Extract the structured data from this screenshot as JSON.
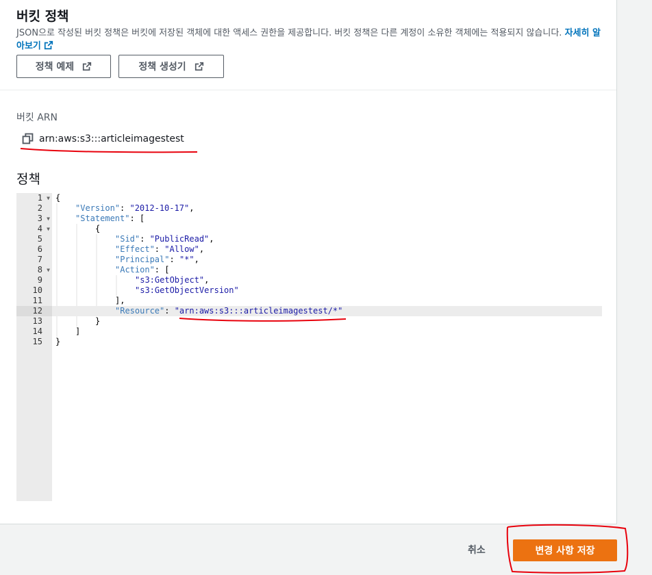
{
  "header": {
    "title": "버킷 정책",
    "description": "JSON으로 작성된 버킷 정책은 버킷에 저장된 객체에 대한 액세스 권한을 제공합니다. 버킷 정책은 다른 계정이 소유한 객체에는 적용되지 않습니다.",
    "learn_more": "자세히 알아보기",
    "buttons": {
      "example": "정책 예제",
      "generator": "정책 생성기"
    }
  },
  "arn": {
    "label": "버킷 ARN",
    "value": "arn:aws:s3:::articleimagestest",
    "icon": "copy-icon"
  },
  "policy": {
    "label": "정책",
    "lines": [
      {
        "n": "1",
        "fold": true,
        "indent": 0,
        "parts": [
          {
            "t": "{",
            "c": "p"
          }
        ]
      },
      {
        "n": "2",
        "fold": false,
        "indent": 1,
        "parts": [
          {
            "t": "\"Version\"",
            "c": "k"
          },
          {
            "t": ": ",
            "c": "p"
          },
          {
            "t": "\"2012-10-17\"",
            "c": "s"
          },
          {
            "t": ",",
            "c": "p"
          }
        ]
      },
      {
        "n": "3",
        "fold": true,
        "indent": 1,
        "parts": [
          {
            "t": "\"Statement\"",
            "c": "k"
          },
          {
            "t": ": [",
            "c": "p"
          }
        ]
      },
      {
        "n": "4",
        "fold": true,
        "indent": 2,
        "parts": [
          {
            "t": "{",
            "c": "p"
          }
        ]
      },
      {
        "n": "5",
        "fold": false,
        "indent": 3,
        "parts": [
          {
            "t": "\"Sid\"",
            "c": "k"
          },
          {
            "t": ": ",
            "c": "p"
          },
          {
            "t": "\"PublicRead\"",
            "c": "s"
          },
          {
            "t": ",",
            "c": "p"
          }
        ]
      },
      {
        "n": "6",
        "fold": false,
        "indent": 3,
        "parts": [
          {
            "t": "\"Effect\"",
            "c": "k"
          },
          {
            "t": ": ",
            "c": "p"
          },
          {
            "t": "\"Allow\"",
            "c": "s"
          },
          {
            "t": ",",
            "c": "p"
          }
        ]
      },
      {
        "n": "7",
        "fold": false,
        "indent": 3,
        "parts": [
          {
            "t": "\"Principal\"",
            "c": "k"
          },
          {
            "t": ": ",
            "c": "p"
          },
          {
            "t": "\"*\"",
            "c": "s"
          },
          {
            "t": ",",
            "c": "p"
          }
        ]
      },
      {
        "n": "8",
        "fold": true,
        "indent": 3,
        "parts": [
          {
            "t": "\"Action\"",
            "c": "k"
          },
          {
            "t": ": [",
            "c": "p"
          }
        ]
      },
      {
        "n": "9",
        "fold": false,
        "indent": 4,
        "parts": [
          {
            "t": "\"s3:GetObject\"",
            "c": "s"
          },
          {
            "t": ",",
            "c": "p"
          }
        ]
      },
      {
        "n": "10",
        "fold": false,
        "indent": 4,
        "parts": [
          {
            "t": "\"s3:GetObjectVersion\"",
            "c": "s"
          }
        ]
      },
      {
        "n": "11",
        "fold": false,
        "indent": 3,
        "parts": [
          {
            "t": "],",
            "c": "p"
          }
        ]
      },
      {
        "n": "12",
        "fold": false,
        "indent": 3,
        "active": true,
        "parts": [
          {
            "t": "\"Resource\"",
            "c": "k"
          },
          {
            "t": ": ",
            "c": "p"
          },
          {
            "t": "\"arn:aws:s3:::articleimagestest/*\"",
            "c": "s"
          }
        ]
      },
      {
        "n": "13",
        "fold": false,
        "indent": 2,
        "parts": [
          {
            "t": "}",
            "c": "p"
          }
        ]
      },
      {
        "n": "14",
        "fold": false,
        "indent": 1,
        "parts": [
          {
            "t": "]",
            "c": "p"
          }
        ]
      },
      {
        "n": "15",
        "fold": false,
        "indent": 0,
        "parts": [
          {
            "t": "}",
            "c": "p"
          }
        ]
      }
    ]
  },
  "footer": {
    "cancel": "취소",
    "save": "변경 사항 저장"
  },
  "colors": {
    "accent": "#ec7211",
    "link": "#0073bb",
    "annotation": "#e8000b"
  }
}
